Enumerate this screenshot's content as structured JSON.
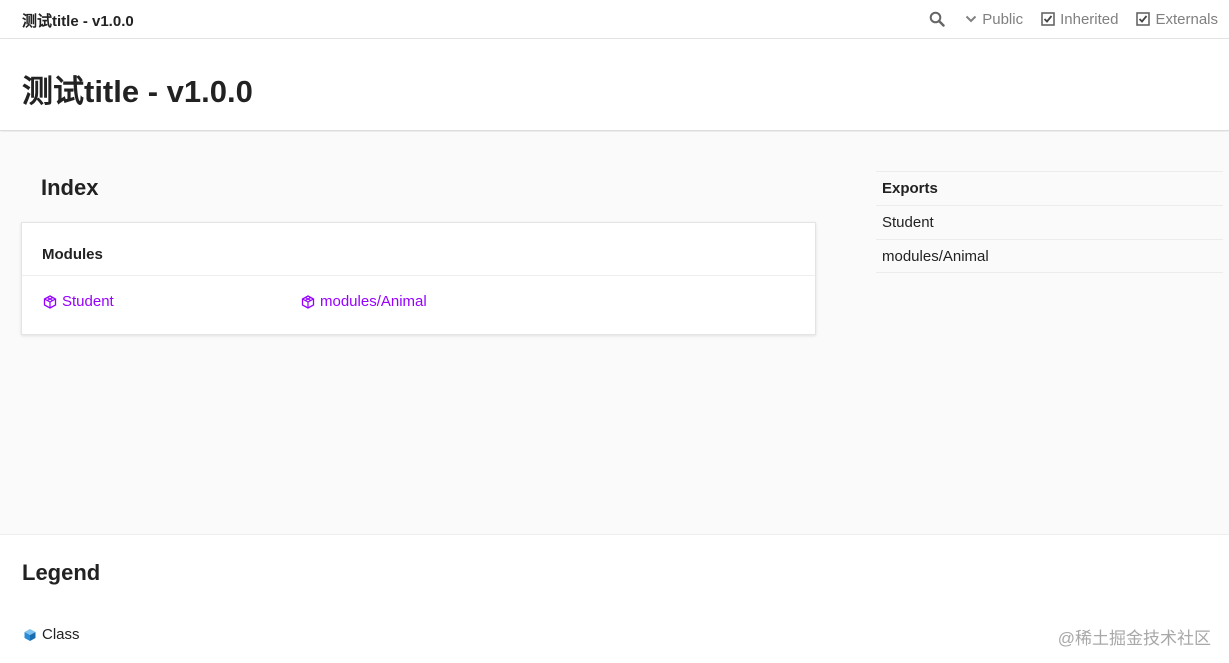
{
  "toolbar": {
    "title": "测试title - v1.0.0",
    "search_icon": "search-icon",
    "filters": [
      {
        "label": "Public",
        "icon": "chevron-down-icon"
      },
      {
        "label": "Inherited",
        "icon": "checkbox-checked-icon",
        "checked": true
      },
      {
        "label": "Externals",
        "icon": "checkbox-checked-icon",
        "checked": true
      }
    ]
  },
  "header": {
    "title": "测试title - v1.0.0"
  },
  "index": {
    "heading": "Index",
    "section_title": "Modules",
    "modules": [
      {
        "label": "Student",
        "icon": "module-icon"
      },
      {
        "label": "modules/Animal",
        "icon": "module-icon"
      }
    ]
  },
  "sidebar": {
    "heading": "Exports",
    "items": [
      {
        "label": "Student"
      },
      {
        "label": "modules/Animal"
      }
    ]
  },
  "legend": {
    "title": "Legend",
    "items": [
      {
        "label": "Class",
        "icon": "class-cube-icon"
      }
    ]
  },
  "watermark": "@稀土掘金技术社区",
  "colors": {
    "link": "#9600ff",
    "class_icon": "#2a8bd6",
    "muted": "#808080"
  }
}
